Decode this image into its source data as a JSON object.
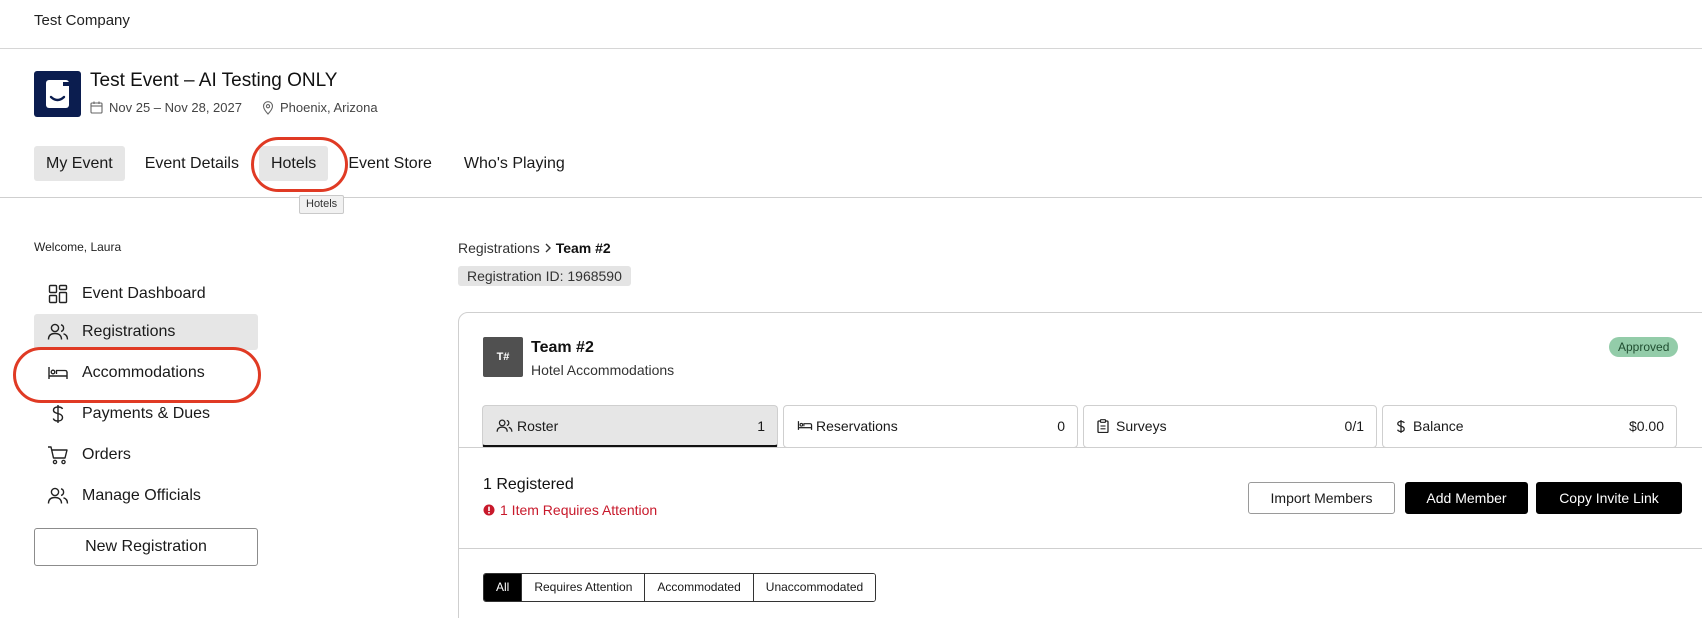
{
  "company": {
    "name": "Test Company"
  },
  "event": {
    "title": "Test Event – AI Testing ONLY",
    "dates": "Nov 25 – Nov 28, 2027",
    "location": "Phoenix, Arizona"
  },
  "nav": {
    "tabs": [
      {
        "label": "My Event",
        "active": true
      },
      {
        "label": "Event Details",
        "active": false
      },
      {
        "label": "Hotels",
        "active": false
      },
      {
        "label": "Event Store",
        "active": false
      },
      {
        "label": "Who's Playing",
        "active": false
      }
    ],
    "tooltip": "Hotels"
  },
  "sidebar": {
    "welcome": "Welcome, Laura",
    "items": [
      {
        "label": "Event Dashboard",
        "icon": "dashboard-icon"
      },
      {
        "label": "Registrations",
        "icon": "users-icon",
        "active": true
      },
      {
        "label": "Accommodations",
        "icon": "bed-icon"
      },
      {
        "label": "Payments & Dues",
        "icon": "dollar-icon"
      },
      {
        "label": "Orders",
        "icon": "cart-icon"
      },
      {
        "label": "Manage Officials",
        "icon": "users-icon"
      }
    ],
    "new_registration": "New Registration"
  },
  "breadcrumb": {
    "parent": "Registrations",
    "current": "Team #2"
  },
  "registration_id": "Registration ID: 1968590",
  "team": {
    "initials": "T#",
    "name": "Team #2",
    "subtitle": "Hotel Accommodations",
    "status": "Approved"
  },
  "stats": [
    {
      "label": "Roster",
      "value": "1",
      "icon": "users-icon"
    },
    {
      "label": "Reservations",
      "value": "0",
      "icon": "bed-icon"
    },
    {
      "label": "Surveys",
      "value": "0/1",
      "icon": "clipboard-icon"
    },
    {
      "label": "Balance",
      "value": "$0.00",
      "icon": "dollar-icon"
    }
  ],
  "roster": {
    "registered": "1 Registered",
    "attention": "1 Item Requires Attention"
  },
  "actions": {
    "import": "Import Members",
    "add": "Add Member",
    "copy": "Copy Invite Link"
  },
  "filters": [
    "All",
    "Requires Attention",
    "Accommodated",
    "Unaccommodated"
  ],
  "colors": {
    "accent": "#000000",
    "approved": "#93cca9",
    "alert": "#c8192b",
    "annotation": "#e03a24"
  }
}
